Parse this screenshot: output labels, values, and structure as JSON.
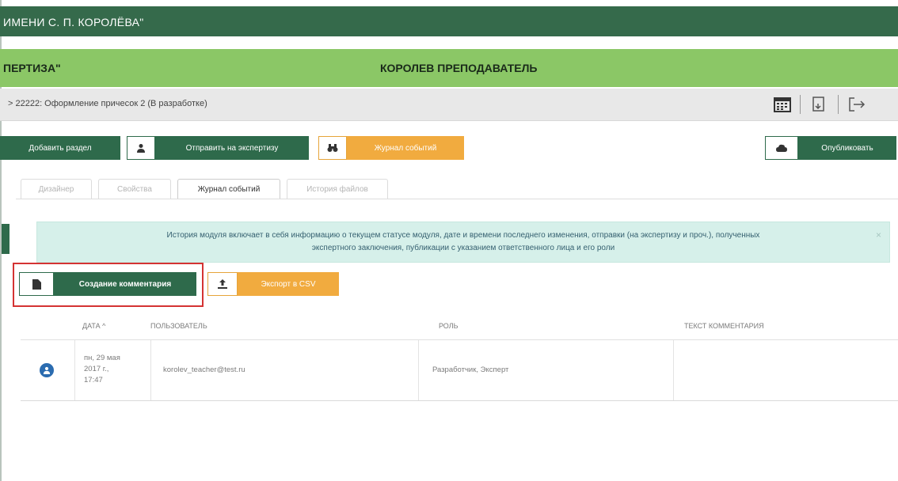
{
  "header": {
    "org_title": "ИМЕНИ С. П. КОРОЛЁВА\"",
    "left_title": "ПЕРТИЗА\"",
    "user_title": "КОРОЛЕВ ПРЕПОДАВАТЕЛЬ"
  },
  "breadcrumb": {
    "text": ">  22222: Оформление причесок 2 (В разработке)"
  },
  "toolbar": {
    "add_section": "Добавить раздел",
    "send_expertise": "Отправить на экспертизу",
    "event_log": "Журнал событий",
    "publish": "Опубликовать"
  },
  "tabs": [
    "Дизайнер",
    "Свойства",
    "Журнал событий",
    "История файлов"
  ],
  "info": {
    "line1": "История модуля включает в себя информацию о текущем статусе модуля, дате и времени последнего изменения, отправки (на экспертизу и проч.), полученных",
    "line2": "экспертного заключения, публикации с указанием ответственного лица и его роли",
    "close": "×"
  },
  "actions": {
    "create_comment": "Создание комментария",
    "export_csv": "Экспорт в CSV"
  },
  "table": {
    "headers": {
      "date": "ДАТА ^",
      "user": "ПОЛЬЗОВАТЕЛЬ",
      "role": "РОЛЬ",
      "comment": "ТЕКСТ КОММЕНТАРИЯ"
    },
    "rows": [
      {
        "date_l1": "пн, 29 мая",
        "date_l2": "2017 г.,",
        "date_l3": "17:47",
        "user": "korolev_teacher@test.ru",
        "role": "Разработчик, Эксперт",
        "comment": ""
      }
    ]
  },
  "colors": {
    "dark_green": "#356a4b",
    "light_green": "#8bc766",
    "orange": "#f1ab3f",
    "info_bg": "#d6f0ea",
    "highlight": "#d43333"
  }
}
